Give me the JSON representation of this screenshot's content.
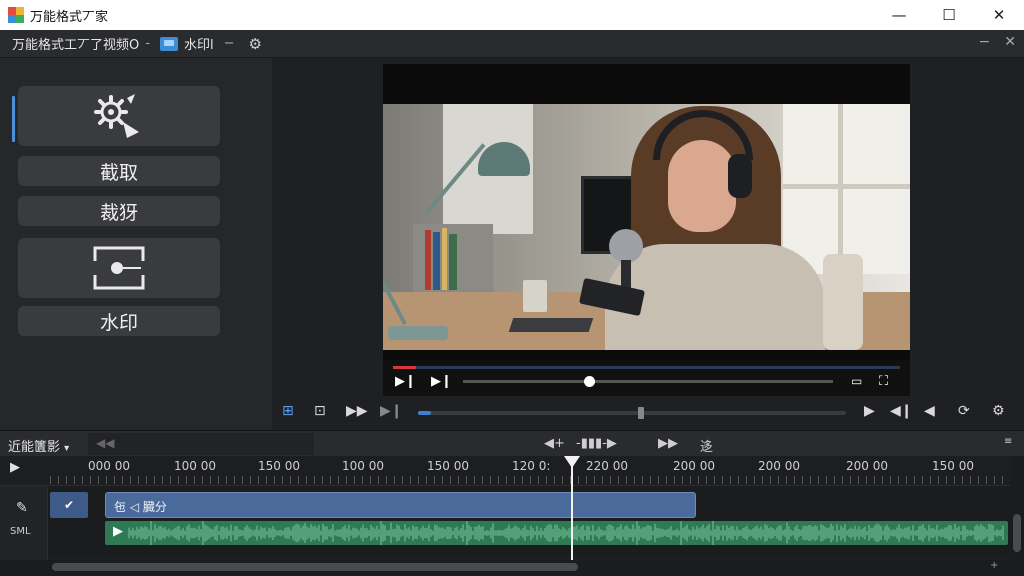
{
  "window": {
    "title": "万能格式丆家",
    "controls": {
      "minimize": "—",
      "maximize": "☐",
      "close": "✕"
    }
  },
  "appbar": {
    "tab_main": "万能格式工丆了视频O",
    "separator": "-",
    "tab_watermark": "水印l",
    "tab_watermark_close": "−",
    "right_minimize": "−",
    "right_close": "✕"
  },
  "left_panel": {
    "tools": [
      {
        "label": "",
        "icon": "gear-plus-icon"
      },
      {
        "label": "截取"
      },
      {
        "label": "裁犽"
      },
      {
        "label": "",
        "icon": "watermark-frame-icon"
      },
      {
        "label": "水印"
      }
    ]
  },
  "video_controls": {
    "progress_fraction": 0.045,
    "scrub_fraction": 0.34
  },
  "transport": {
    "progress_fraction": 0.03,
    "knob_fraction": 0.52
  },
  "timeline": {
    "title": "近能籄影",
    "title_caret": "▾",
    "fast_label": "迻",
    "ruler_labels": [
      "000 00",
      "100 00",
      "150 00",
      "100 00",
      "150 00",
      "120 0:",
      "220 00",
      "200 00",
      "200 00",
      "200 00",
      "150 00"
    ],
    "track_label": "SML",
    "video_clip_label": "㐌 ◁ 臓分",
    "audio_play": "▶"
  },
  "colors": {
    "accent": "#3d7fd1",
    "video_clip": "#4b6a9c",
    "audio_clip": "#2e7a55",
    "progress_red": "#d9383c"
  }
}
